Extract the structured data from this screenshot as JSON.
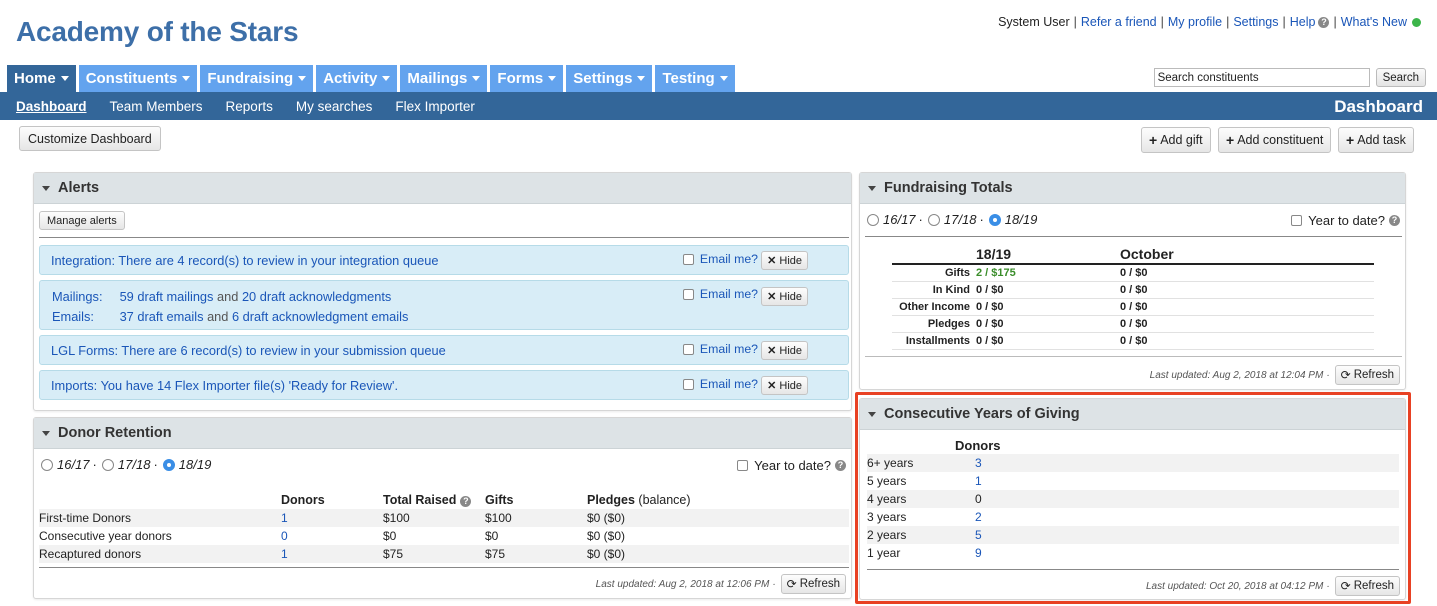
{
  "org_name": "Academy of the Stars",
  "utility": {
    "user": "System User",
    "links": [
      "Refer a friend",
      "My profile",
      "Settings",
      "Help",
      "What's New"
    ]
  },
  "main_nav": [
    {
      "label": "Home"
    },
    {
      "label": "Constituents"
    },
    {
      "label": "Fundraising"
    },
    {
      "label": "Activity"
    },
    {
      "label": "Mailings"
    },
    {
      "label": "Forms"
    },
    {
      "label": "Settings"
    },
    {
      "label": "Testing"
    }
  ],
  "search": {
    "value": "Search constituents",
    "button": "Search"
  },
  "sub_nav": [
    "Dashboard",
    "Team Members",
    "Reports",
    "My searches",
    "Flex Importer"
  ],
  "page_label": "Dashboard",
  "toolbar": {
    "customize": "Customize Dashboard",
    "add_gift": "Add gift",
    "add_constituent": "Add constituent",
    "add_task": "Add task"
  },
  "alerts": {
    "title": "Alerts",
    "manage": "Manage alerts",
    "email_label": "Email me?",
    "hide_label": "Hide",
    "integration": {
      "label": "Integration:",
      "text": "There are 4 record(s) to review in your integration queue"
    },
    "mailings": {
      "label": "Mailings:",
      "part1": "59 draft mailings",
      "and": "and",
      "part2": "20 draft acknowledgments"
    },
    "emails": {
      "label": "Emails:",
      "part1": "37 draft emails",
      "and": "and",
      "part2": "6 draft acknowledgment emails"
    },
    "lgl": {
      "label": "LGL Forms:",
      "text": "There are 6 record(s) to review in your submission queue"
    },
    "imports": {
      "label": "Imports:",
      "text": "You have 14 Flex Importer file(s) 'Ready for Review'."
    }
  },
  "donor_retention": {
    "title": "Donor Retention",
    "years": [
      "16/17",
      "17/18",
      "18/19"
    ],
    "selected": "18/19",
    "ytd": "Year to date?",
    "headers": {
      "donors": "Donors",
      "total": "Total Raised",
      "gifts": "Gifts",
      "pledges": "Pledges",
      "balance": "(balance)"
    },
    "rows": [
      {
        "label": "First-time Donors",
        "donors": "1",
        "total": "$100",
        "gifts": "$100",
        "pledges": "$0 ($0)"
      },
      {
        "label": "Consecutive year donors",
        "donors": "0",
        "total": "$0",
        "gifts": "$0",
        "pledges": "$0 ($0)"
      },
      {
        "label": "Recaptured donors",
        "donors": "1",
        "total": "$75",
        "gifts": "$75",
        "pledges": "$0 ($0)"
      }
    ],
    "updated": "Last updated: Aug 2, 2018 at 12:06 PM",
    "refresh": "Refresh"
  },
  "fundraising_totals": {
    "title": "Fundraising Totals",
    "years": [
      "16/17",
      "17/18",
      "18/19"
    ],
    "selected": "18/19",
    "ytd": "Year to date?",
    "col1": "18/19",
    "col2": "October",
    "rows": [
      {
        "label": "Gifts",
        "year": "2 / $175",
        "month": "0 / $0"
      },
      {
        "label": "In Kind",
        "year": "0 / $0",
        "month": "0 / $0"
      },
      {
        "label": "Other Income",
        "year": "0 / $0",
        "month": "0 / $0"
      },
      {
        "label": "Pledges",
        "year": "0 / $0",
        "month": "0 / $0"
      },
      {
        "label": "Installments",
        "year": "0 / $0",
        "month": "0 / $0"
      }
    ],
    "updated": "Last updated: Aug 2, 2018 at 12:04 PM",
    "refresh": "Refresh"
  },
  "consecutive_years": {
    "title": "Consecutive Years of Giving",
    "header": "Donors",
    "rows": [
      {
        "label": "6+ years",
        "value": "3"
      },
      {
        "label": "5 years",
        "value": "1"
      },
      {
        "label": "4 years",
        "value": "0"
      },
      {
        "label": "3 years",
        "value": "2"
      },
      {
        "label": "2 years",
        "value": "5"
      },
      {
        "label": "1 year",
        "value": "9"
      }
    ],
    "updated": "Last updated: Oct 20, 2018 at 04:12 PM",
    "refresh": "Refresh"
  },
  "colors": {
    "brand": "#336699",
    "tab": "#63a3ee",
    "link": "#1a56b8",
    "highlight": "#e84123"
  }
}
